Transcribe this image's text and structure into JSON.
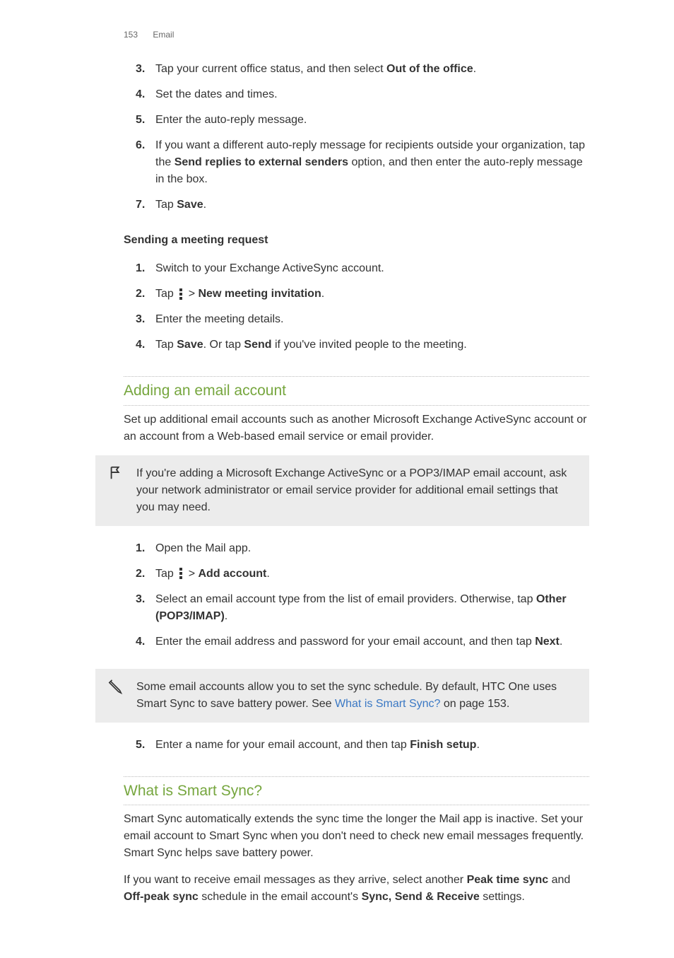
{
  "header": {
    "page_number": "153",
    "section": "Email"
  },
  "listA": {
    "items": [
      {
        "n": "3.",
        "pre": "Tap your current office status, and then select ",
        "bold": "Out of the office",
        "post": "."
      },
      {
        "n": "4.",
        "pre": "Set the dates and times.",
        "bold": "",
        "post": ""
      },
      {
        "n": "5.",
        "pre": "Enter the auto-reply message.",
        "bold": "",
        "post": ""
      },
      {
        "n": "6.",
        "pre": "If you want a different auto-reply message for recipients outside your organization, tap the ",
        "bold": "Send replies to external senders",
        "post": " option, and then enter the auto-reply message in the box."
      },
      {
        "n": "7.",
        "pre": "Tap ",
        "bold": "Save",
        "post": "."
      }
    ]
  },
  "subheadA": "Sending a meeting request",
  "listB": {
    "i1": {
      "n": "1.",
      "text": "Switch to your Exchange ActiveSync account."
    },
    "i2": {
      "n": "2.",
      "pre": "Tap ",
      "mid": " > ",
      "bold": "New meeting invitation",
      "post": "."
    },
    "i3": {
      "n": "3.",
      "text": "Enter the meeting details."
    },
    "i4": {
      "n": "4.",
      "pre": "Tap ",
      "b1": "Save",
      "mid1": ". Or tap ",
      "b2": "Send",
      "post": " if you've invited people to the meeting."
    }
  },
  "section1": {
    "title": "Adding an email account",
    "intro": "Set up additional email accounts such as another Microsoft Exchange ActiveSync account or an account from a Web-based email service or email provider."
  },
  "callout1": "If you're adding a Microsoft Exchange ActiveSync or a POP3/IMAP email account, ask your network administrator or email service provider for additional email settings that you may need.",
  "listC": {
    "i1": {
      "n": "1.",
      "text": "Open the Mail app."
    },
    "i2": {
      "n": "2.",
      "pre": "Tap ",
      "mid": " > ",
      "bold": "Add account",
      "post": "."
    },
    "i3": {
      "n": "3.",
      "pre": "Select an email account type from the list of email providers. Otherwise, tap ",
      "bold": "Other (POP3/IMAP)",
      "post": "."
    },
    "i4": {
      "n": "4.",
      "pre": "Enter the email address and password for your email account, and then tap ",
      "bold": "Next",
      "post": "."
    }
  },
  "callout2": {
    "pre": "Some email accounts allow you to set the sync schedule. By default, HTC One uses Smart Sync to save battery power. See ",
    "link": "What is Smart Sync?",
    "post": " on page 153."
  },
  "listD": {
    "i5": {
      "n": "5.",
      "pre": "Enter a name for your email account, and then tap ",
      "bold": "Finish setup",
      "post": "."
    }
  },
  "section2": {
    "title": "What is Smart Sync?",
    "p1": "Smart Sync automatically extends the sync time the longer the Mail app is inactive. Set your email account to Smart Sync when you don't need to check new email messages frequently. Smart Sync helps save battery power.",
    "p2": {
      "pre": "If you want to receive email messages as they arrive, select another ",
      "b1": "Peak time sync",
      "mid1": " and ",
      "b2": "Off-peak sync",
      "mid2": " schedule in the email account's ",
      "b3": "Sync, Send & Receive",
      "post": " settings."
    }
  }
}
